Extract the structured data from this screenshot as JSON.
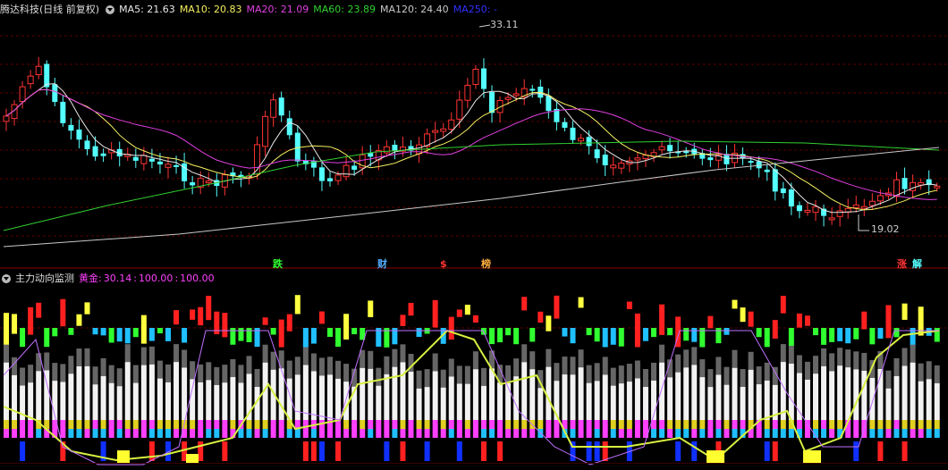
{
  "price_panel": {
    "title": "腾达科技(日线 前复权)",
    "ma_labels": [
      {
        "text": "MA5: 21.63",
        "color": "#e8e8e8"
      },
      {
        "text": "MA10: 20.83",
        "color": "#f5f060"
      },
      {
        "text": "MA20: 21.09",
        "color": "#e040e0"
      },
      {
        "text": "MA60: 23.89",
        "color": "#30d030"
      },
      {
        "text": "MA120: 24.40",
        "color": "#c8c8c8"
      },
      {
        "text": "MA250: -",
        "color": "#3030ff"
      }
    ],
    "high_label": "33.11",
    "low_label": "19.02",
    "up_color": "#ff3333",
    "down_color": "#54ffff"
  },
  "event_markers": [
    {
      "text": "跌",
      "color": "#30ff30"
    },
    {
      "text": "财",
      "color": "#54b0ff"
    },
    {
      "text": "$",
      "color": "#ff3333"
    },
    {
      "text": "榜",
      "color": "#ffb040"
    },
    {
      "text": "涨",
      "color": "#ff3333"
    },
    {
      "text": "解",
      "color": "#54ffff"
    }
  ],
  "indicator_panel": {
    "title": "主力动向监测",
    "label": "黄金:",
    "values": [
      "30.14",
      "100.00",
      "100.00"
    ],
    "label_color": "#ff40ff",
    "value_color": "#ff40ff"
  }
}
